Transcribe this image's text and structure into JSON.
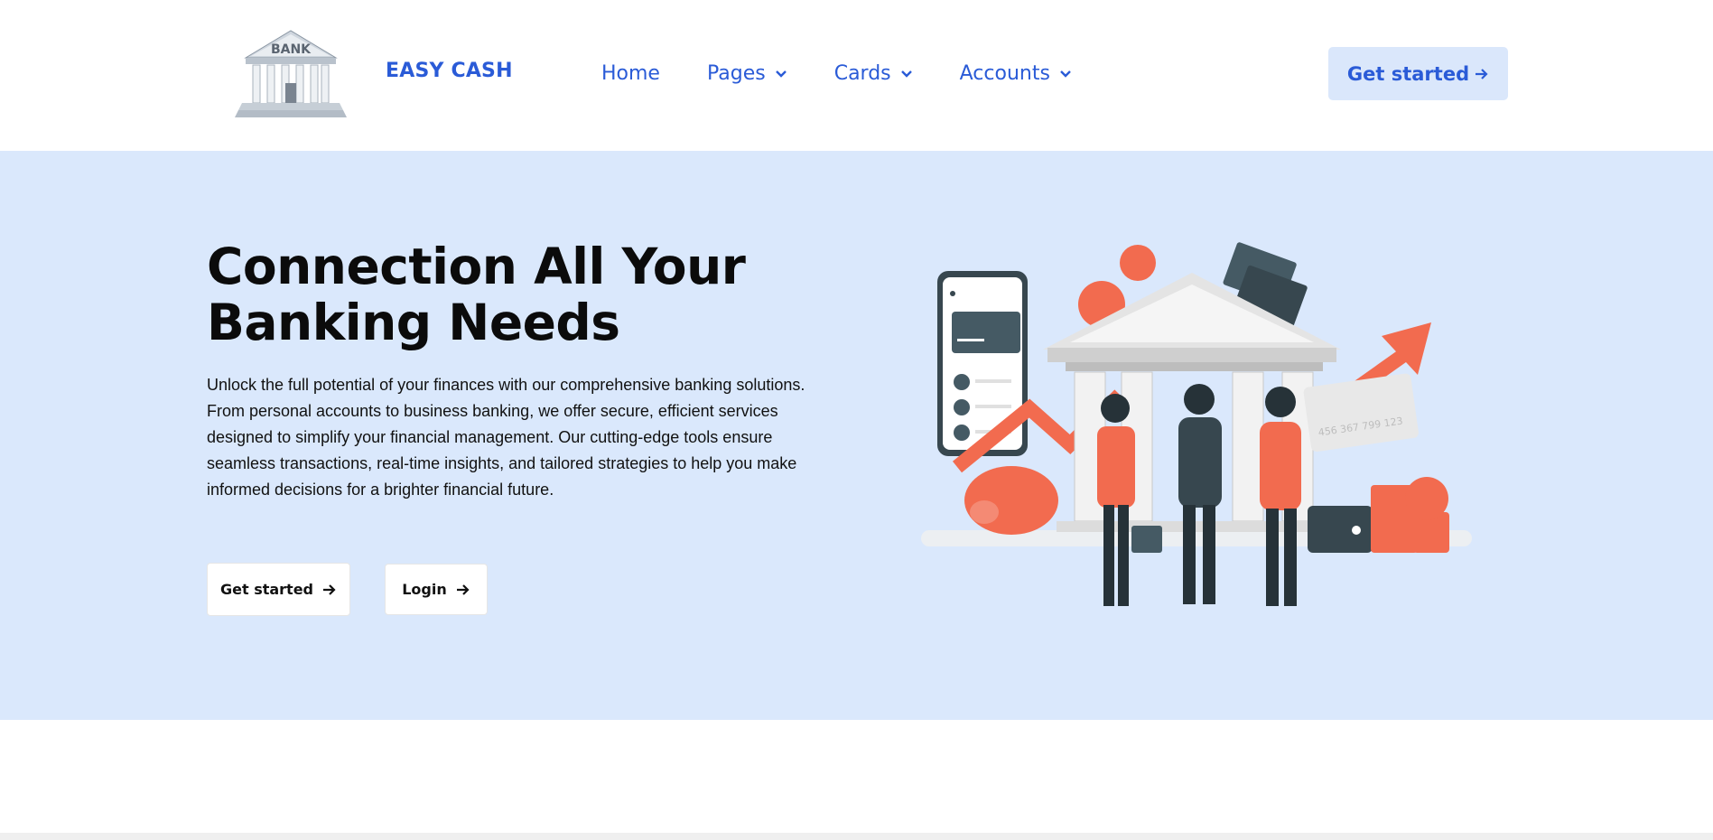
{
  "header": {
    "brand": "EASY CASH",
    "logo_text": "BANK",
    "nav": [
      {
        "label": "Home",
        "dropdown": false
      },
      {
        "label": "Pages",
        "dropdown": true
      },
      {
        "label": "Cards",
        "dropdown": true
      },
      {
        "label": "Accounts",
        "dropdown": true
      }
    ],
    "cta_label": "Get started",
    "cta_icon": "arrow-right-icon"
  },
  "hero": {
    "title_line1": "Connection All Your",
    "title_line2": "Banking Needs",
    "description": "Unlock the full potential of your finances with our comprehensive banking solutions. From personal accounts to business banking, we offer secure, efficient services designed to simplify your financial management. Our cutting-edge tools ensure seamless transactions, real-time insights, and tailored strategies to help you make informed decisions for a brighter financial future.",
    "primary_button": "Get started",
    "secondary_button": "Login",
    "illustration_card_number": "456 367 799 123"
  },
  "colors": {
    "brand_blue": "#2a5bd7",
    "hero_bg": "#dae8fc",
    "cta_bg": "#dae7fb",
    "accent_coral": "#f26b4f",
    "dark_slate": "#37474f"
  }
}
